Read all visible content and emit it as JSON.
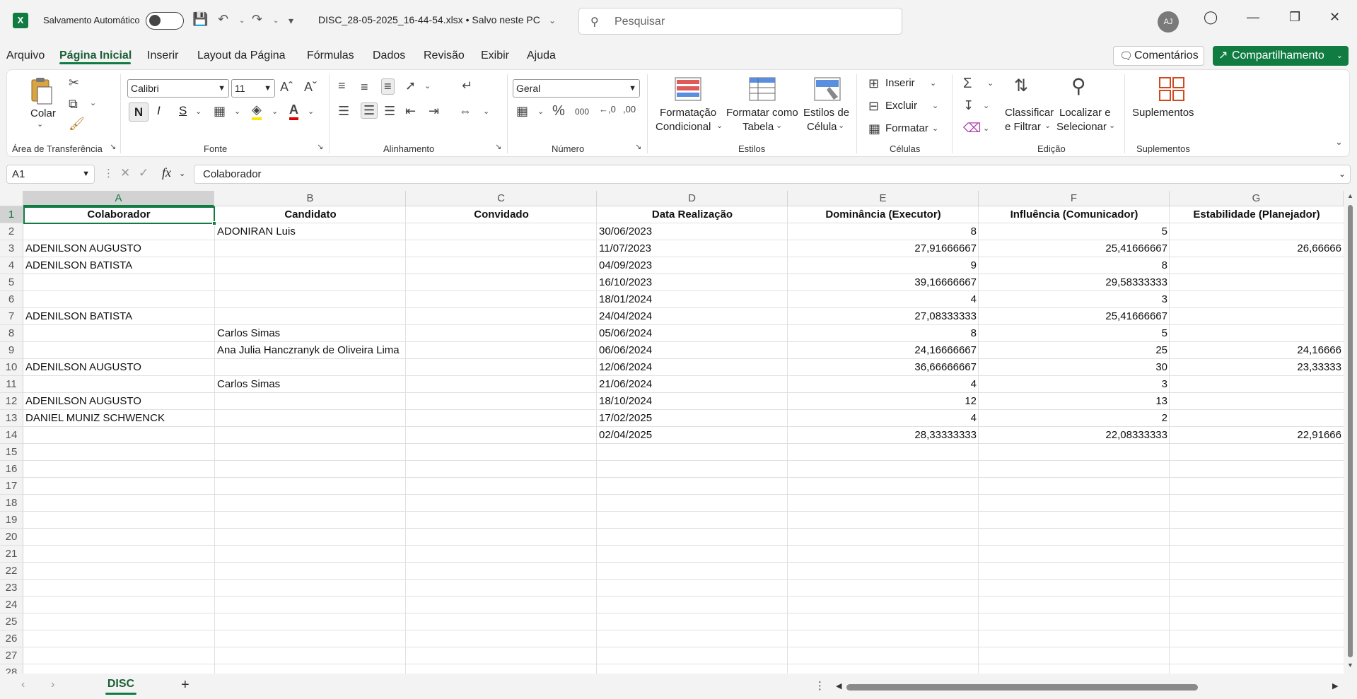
{
  "titlebar": {
    "autosave_label": "Salvamento Automático",
    "document_title": "DISC_28-05-2025_16-44-54.xlsx • Salvo neste PC",
    "search_placeholder": "Pesquisar",
    "avatar_initials": "AJ"
  },
  "menu": {
    "tabs": [
      "Arquivo",
      "Página Inicial",
      "Inserir",
      "Layout da Página",
      "Fórmulas",
      "Dados",
      "Revisão",
      "Exibir",
      "Ajuda"
    ],
    "comments_label": "Comentários",
    "share_label": "Compartilhamento"
  },
  "ribbon": {
    "clipboard": {
      "paste_label": "Colar",
      "group_label": "Área de Transferência"
    },
    "font": {
      "font_name": "Calibri",
      "font_size": "11",
      "bold": "N",
      "italic": "I",
      "underline": "S",
      "group_label": "Fonte"
    },
    "alignment": {
      "group_label": "Alinhamento"
    },
    "number": {
      "format": "Geral",
      "group_label": "Número"
    },
    "styles": {
      "conditional_line1": "Formatação",
      "conditional_line2": "Condicional",
      "table_line1": "Formatar como",
      "table_line2": "Tabela",
      "cell_line1": "Estilos de",
      "cell_line2": "Célula",
      "group_label": "Estilos"
    },
    "cells": {
      "insert": "Inserir",
      "delete": "Excluir",
      "format": "Formatar",
      "group_label": "Células"
    },
    "editing": {
      "sort_line1": "Classificar",
      "sort_line2": "e Filtrar",
      "find_line1": "Localizar e",
      "find_line2": "Selecionar",
      "group_label": "Edição"
    },
    "addins": {
      "label": "Suplementos",
      "group_label": "Suplementos"
    }
  },
  "formula_bar": {
    "name_box": "A1",
    "fx": "fx",
    "content": "Colaborador"
  },
  "sheet": {
    "columns": [
      "A",
      "B",
      "C",
      "D",
      "E",
      "F",
      "G"
    ],
    "row_numbers": [
      "1",
      "2",
      "3",
      "4",
      "5",
      "6",
      "7",
      "8",
      "9",
      "10",
      "11",
      "12",
      "13",
      "14",
      "15",
      "16",
      "17",
      "18",
      "19",
      "20",
      "21",
      "22",
      "23",
      "24",
      "25",
      "26",
      "27",
      "28"
    ],
    "header": [
      "Colaborador",
      "Candidato",
      "Convidado",
      "Data Realização",
      "Dominância (Executor)",
      "Influência (Comunicador)",
      "Estabilidade (Planejador)"
    ],
    "rows": [
      [
        "",
        "ADONIRAN Luis",
        "",
        "30/06/2023",
        "8",
        "5",
        ""
      ],
      [
        "ADENILSON AUGUSTO",
        "",
        "",
        "11/07/2023",
        "27,91666667",
        "25,41666667",
        "26,66666"
      ],
      [
        "ADENILSON BATISTA",
        "",
        "",
        "04/09/2023",
        "9",
        "8",
        ""
      ],
      [
        "",
        "",
        "",
        "16/10/2023",
        "39,16666667",
        "29,58333333",
        ""
      ],
      [
        "",
        "",
        "",
        "18/01/2024",
        "4",
        "3",
        ""
      ],
      [
        "ADENILSON BATISTA",
        "",
        "",
        "24/04/2024",
        "27,08333333",
        "25,41666667",
        ""
      ],
      [
        "",
        "Carlos Simas",
        "",
        "05/06/2024",
        "8",
        "5",
        ""
      ],
      [
        "",
        "Ana Julia Hanczranyk de Oliveira Lima",
        "",
        "06/06/2024",
        "24,16666667",
        "25",
        "24,16666"
      ],
      [
        "ADENILSON AUGUSTO",
        "",
        "",
        "12/06/2024",
        "36,66666667",
        "30",
        "23,33333"
      ],
      [
        "",
        "Carlos Simas",
        "",
        "21/06/2024",
        "4",
        "3",
        ""
      ],
      [
        "ADENILSON AUGUSTO",
        "",
        "",
        "18/10/2024",
        "12",
        "13",
        ""
      ],
      [
        "DANIEL MUNIZ SCHWENCK",
        "",
        "",
        "17/02/2025",
        "4",
        "2",
        ""
      ],
      [
        "",
        "",
        "",
        "02/04/2025",
        "28,33333333",
        "22,08333333",
        "22,91666"
      ]
    ],
    "sheet_tab": "DISC"
  },
  "colors": {
    "accent": "#107c41"
  }
}
